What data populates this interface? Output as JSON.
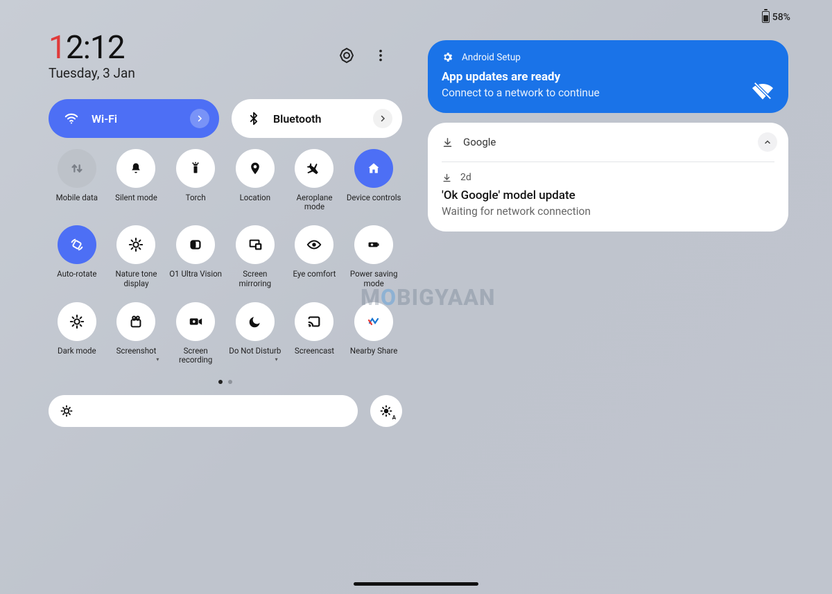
{
  "status": {
    "battery": "58%"
  },
  "clock": {
    "first_digit": "1",
    "rest": "2:12",
    "date": "Tuesday, 3 Jan"
  },
  "pills": {
    "wifi": {
      "label": "Wi-Fi"
    },
    "bluetooth": {
      "label": "Bluetooth"
    }
  },
  "tiles": [
    {
      "label": "Mobile data"
    },
    {
      "label": "Silent mode"
    },
    {
      "label": "Torch"
    },
    {
      "label": "Location"
    },
    {
      "label": "Aeroplane mode"
    },
    {
      "label": "Device controls"
    },
    {
      "label": "Auto-rotate"
    },
    {
      "label": "Nature tone display"
    },
    {
      "label": "O1 Ultra Vision"
    },
    {
      "label": "Screen mirroring"
    },
    {
      "label": "Eye comfort"
    },
    {
      "label": "Power saving mode"
    },
    {
      "label": "Dark mode"
    },
    {
      "label": "Screenshot"
    },
    {
      "label": "Screen recording"
    },
    {
      "label": "Do Not Disturb"
    },
    {
      "label": "Screencast"
    },
    {
      "label": "Nearby Share"
    }
  ],
  "notifications": {
    "setup": {
      "app": "Android Setup",
      "title": "App updates are ready",
      "subtitle": "Connect to a network to continue"
    },
    "google": {
      "app": "Google",
      "age": "2d",
      "title": "'Ok Google' model update",
      "subtitle": "Waiting for network connection"
    }
  },
  "watermark": "MOBIGYAAN"
}
